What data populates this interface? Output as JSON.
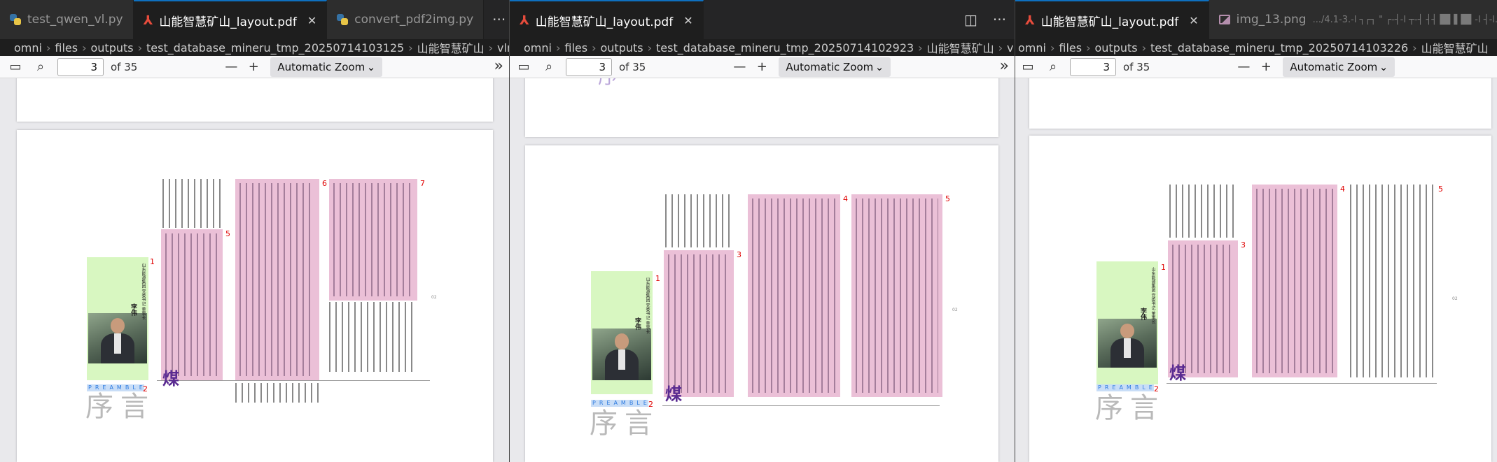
{
  "group1": {
    "tabs": [
      {
        "label": "test_qwen_vl.py",
        "icon": "python-file-icon",
        "active": false
      },
      {
        "label": "山能智慧矿山_layout.pdf",
        "icon": "pdf-file-icon",
        "active": true
      },
      {
        "label": "convert_pdf2img.py",
        "icon": "python-file-icon",
        "active": false
      }
    ],
    "more": "···",
    "breadcrumb": [
      "omni",
      "files",
      "outputs",
      "test_database_mineru_tmp_20250714103125",
      "山能智慧矿山",
      "vlm"
    ],
    "page_number": "3",
    "page_total": "of 35",
    "zoom": "Automatic Zoom"
  },
  "group2": {
    "tabs": [
      {
        "label": "山能智慧矿山_layout.pdf",
        "icon": "pdf-file-icon",
        "active": true
      }
    ],
    "more": "···",
    "breadcrumb": [
      "omni",
      "files",
      "outputs",
      "test_database_mineru_tmp_20250714102923",
      "山能智慧矿山",
      "vlm"
    ],
    "page_number": "3",
    "page_total": "of 35",
    "zoom": "Automatic Zoom"
  },
  "group3": {
    "tabs": [
      {
        "label": "山能智慧矿山_layout.pdf",
        "icon": "pdf-file-icon",
        "active": true
      },
      {
        "label": "img_13.png",
        "icon": "image-file-icon",
        "active": false
      }
    ],
    "tab_suffix": ".../4.1-3.-l ┐┌┐ \" ┌-┤-l ┬-┤ ┤┤ █▌▌█▌-l ┤-l.pdf",
    "breadcrumb": [
      "omni",
      "files",
      "outputs",
      "test_database_mineru_tmp_20250714103226",
      "山能智慧矿山"
    ],
    "page_number": "3",
    "page_total": "of 35",
    "zoom": "Automatic Zoom"
  },
  "pdf": {
    "title_chars": [
      "序",
      "言"
    ],
    "preamble": "PREAMBLE",
    "coal_char": "煤",
    "author_name": "李伟",
    "author_title": "山东能源集团 党委书记 董事长",
    "page_no": "02",
    "labels_g1": [
      "1",
      "2",
      "5",
      "6",
      "7"
    ],
    "labels_g2": [
      "1",
      "2",
      "3",
      "4",
      "5"
    ],
    "labels_g3": [
      "1",
      "2",
      "3",
      "4",
      "5"
    ]
  }
}
